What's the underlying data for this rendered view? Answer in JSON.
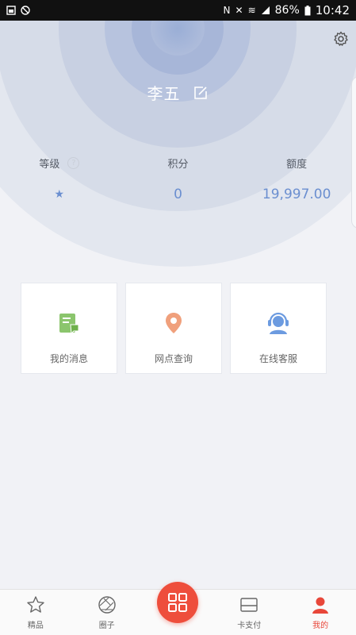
{
  "status_bar": {
    "time": "10:42",
    "battery": "86%",
    "left_icons": [
      "screenshot-icon",
      "no-disturb-icon"
    ],
    "right_icons": [
      "nfc-icon",
      "mute-icon",
      "wifi-icon",
      "signal-icon",
      "battery-icon"
    ]
  },
  "profile": {
    "username": "李五"
  },
  "stats": [
    {
      "label": "等级",
      "value": "★"
    },
    {
      "label": "积分",
      "value": "0"
    },
    {
      "label": "额度",
      "value": "19,997.00"
    }
  ],
  "cards": [
    {
      "label": "我的消息",
      "icon": "message-icon"
    },
    {
      "label": "网点查询",
      "icon": "location-pin-icon"
    },
    {
      "label": "在线客服",
      "icon": "customer-service-icon"
    }
  ],
  "nav": {
    "items": [
      {
        "label": "精品",
        "icon": "star-outline-icon"
      },
      {
        "label": "圈子",
        "icon": "aperture-icon"
      },
      {
        "label": "",
        "icon": "grid-icon"
      },
      {
        "label": "卡支付",
        "icon": "card-icon"
      },
      {
        "label": "我的",
        "icon": "person-icon"
      }
    ],
    "active_index": 4
  },
  "colors": {
    "accent_red": "#ee4e3c",
    "stat_blue": "#6b8fd0",
    "ring_blue": "#8fa6d2",
    "message_green": "#8bc56d",
    "location_orange": "#f0a07c",
    "service_blue": "#6c9be0"
  }
}
